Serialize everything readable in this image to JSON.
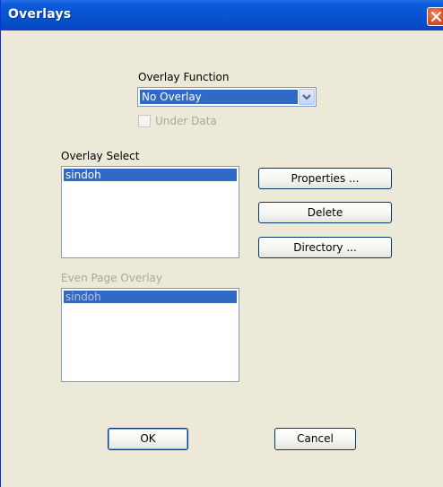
{
  "window": {
    "title": "Overlays"
  },
  "overlay_function": {
    "label": "Overlay Function",
    "selected": "No Overlay",
    "under_data_label": "Under Data"
  },
  "overlay_select": {
    "label": "Overlay Select",
    "items": [
      "sindoh"
    ]
  },
  "even_page_overlay": {
    "label": "Even Page Overlay",
    "items": [
      "sindoh"
    ]
  },
  "buttons": {
    "properties": "Properties ...",
    "delete": "Delete",
    "directory": "Directory ...",
    "ok": "OK",
    "cancel": "Cancel"
  },
  "icons": {
    "close": "close-icon",
    "dropdown": "chevron-down-icon"
  },
  "colors": {
    "titlebar": "#0A55D3",
    "selection": "#316AC5",
    "dialog_bg": "#ECE9D8",
    "close_button": "#D9542A"
  }
}
